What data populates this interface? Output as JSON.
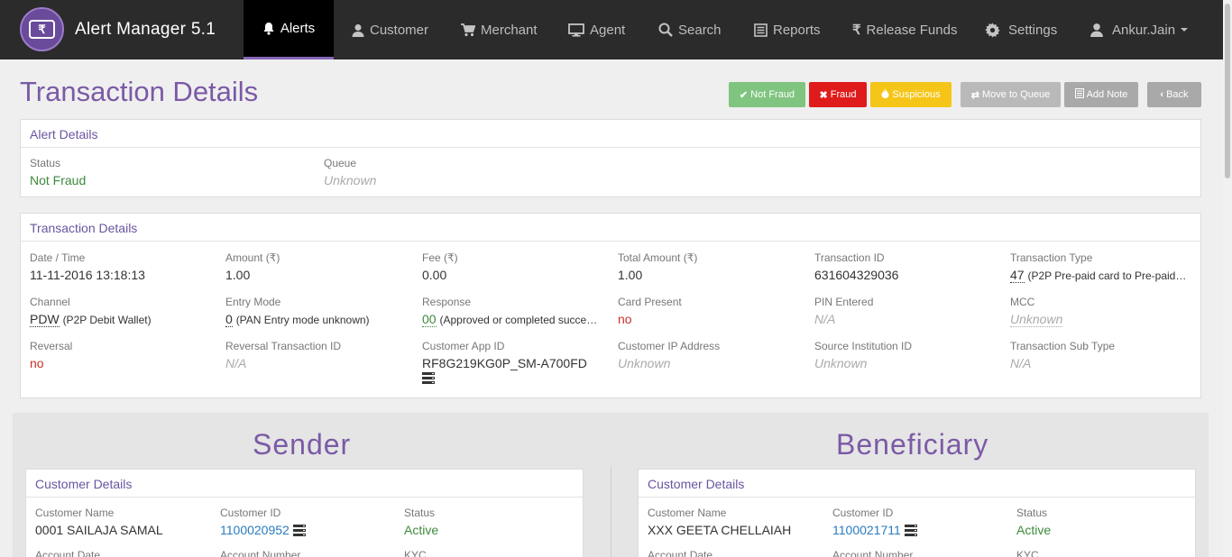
{
  "app": {
    "title": "Alert Manager 5.1",
    "logo_symbol": "₹"
  },
  "nav": {
    "alerts": "Alerts",
    "customer": "Customer",
    "merchant": "Merchant",
    "agent": "Agent",
    "search": "Search",
    "reports": "Reports",
    "release_funds": "Release Funds",
    "settings": "Settings",
    "user": "Ankur.Jain"
  },
  "page": {
    "title": "Transaction Details"
  },
  "actions": {
    "not_fraud": "Not Fraud",
    "fraud": "Fraud",
    "suspicious": "Suspicious",
    "move_to_queue": "Move to Queue",
    "add_note": "Add Note",
    "back": "Back"
  },
  "alert_details": {
    "heading": "Alert Details",
    "status_label": "Status",
    "status_value": "Not Fraud",
    "queue_label": "Queue",
    "queue_value": "Unknown"
  },
  "transaction": {
    "heading": "Transaction Details",
    "date_label": "Date / Time",
    "date_value": "11-11-2016 13:18:13",
    "amount_label": "Amount (₹)",
    "amount_value": "1.00",
    "fee_label": "Fee (₹)",
    "fee_value": "0.00",
    "total_label": "Total Amount (₹)",
    "total_value": "1.00",
    "txn_id_label": "Transaction ID",
    "txn_id_value": "631604329036",
    "txn_type_label": "Transaction Type",
    "txn_type_code": "47",
    "txn_type_desc": "(P2P Pre-paid card to Pre-paid…",
    "channel_label": "Channel",
    "channel_code": "PDW",
    "channel_desc": "(P2P Debit Wallet)",
    "entry_mode_label": "Entry Mode",
    "entry_mode_code": "0",
    "entry_mode_desc": "(PAN Entry mode unknown)",
    "response_label": "Response",
    "response_code": "00",
    "response_desc": "(Approved or completed succe…",
    "card_present_label": "Card Present",
    "card_present_value": "no",
    "pin_label": "PIN Entered",
    "pin_value": "N/A",
    "mcc_label": "MCC",
    "mcc_value": "Unknown",
    "reversal_label": "Reversal",
    "reversal_value": "no",
    "reversal_txn_label": "Reversal Transaction ID",
    "reversal_txn_value": "N/A",
    "app_id_label": "Customer App ID",
    "app_id_value": "RF8G219KG0P_SM-A700FD",
    "ip_label": "Customer IP Address",
    "ip_value": "Unknown",
    "source_label": "Source Institution ID",
    "source_value": "Unknown",
    "subtype_label": "Transaction Sub Type",
    "subtype_value": "N/A"
  },
  "sender": {
    "title": "Sender",
    "heading": "Customer Details",
    "name_label": "Customer Name",
    "name_value": "0001 SAILAJA SAMAL",
    "id_label": "Customer ID",
    "id_value": "1100020952",
    "status_label": "Status",
    "status_value": "Active",
    "acc_date_label": "Account Date",
    "acc_num_label": "Account Number",
    "kyc_label": "KYC"
  },
  "beneficiary": {
    "title": "Beneficiary",
    "heading": "Customer Details",
    "name_label": "Customer Name",
    "name_value": "XXX GEETA CHELLAIAH",
    "id_label": "Customer ID",
    "id_value": "1100021711",
    "status_label": "Status",
    "status_value": "Active",
    "acc_date_label": "Account Date",
    "acc_num_label": "Account Number",
    "kyc_label": "KYC"
  },
  "colors": {
    "brand_purple": "#7b5aa6",
    "navbar": "#2b2b2b",
    "btn_not_fraud": "#7fc47f",
    "btn_fraud": "#e01b1b",
    "btn_suspicious": "#f5c518",
    "btn_gray": "#a9a9a9"
  },
  "icons": {
    "alerts": "bell-icon",
    "customer": "user-icon",
    "merchant": "cart-icon",
    "agent": "monitor-icon",
    "search": "search-icon",
    "reports": "list-icon",
    "release_funds": "rupee-icon",
    "settings": "gear-icon",
    "user": "user-icon"
  }
}
